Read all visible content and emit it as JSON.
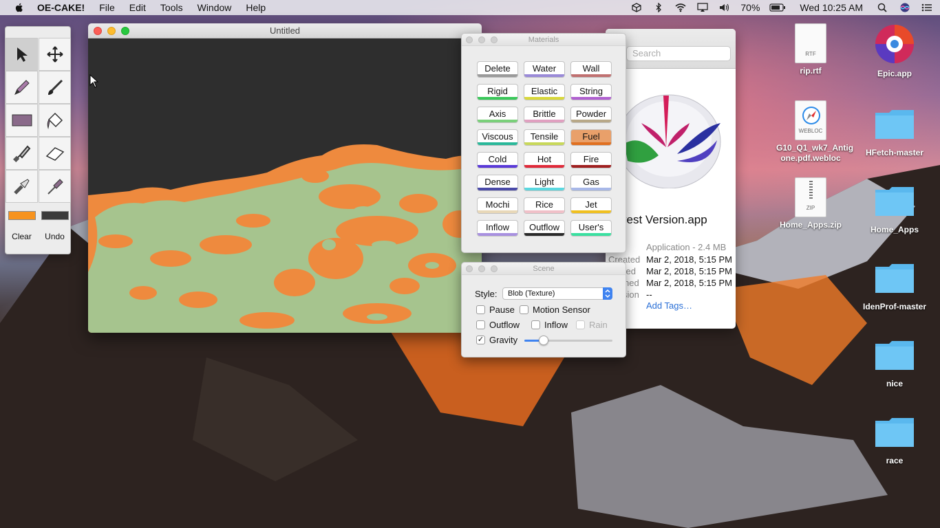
{
  "menubar": {
    "app_name": "OE-CAKE!",
    "items": [
      "File",
      "Edit",
      "Tools",
      "Window",
      "Help"
    ],
    "battery": "70%",
    "clock": "Wed 10:25 AM"
  },
  "palette": {
    "tools": [
      "arrow-select",
      "move",
      "pencil",
      "brush",
      "rectangle",
      "paint-bucket",
      "knife",
      "eraser",
      "flashlight",
      "dropper"
    ],
    "swatch1_color": "#f7931e",
    "swatch2_color": "#3a3a3a",
    "clear_label": "Clear",
    "undo_label": "Undo"
  },
  "canvas_window": {
    "title": "Untitled"
  },
  "finder": {
    "search_placeholder": "Search",
    "app_name_partial": "vest Version.app",
    "kind_size": "Application - 2.4 MB",
    "rows": [
      {
        "key": "Created",
        "value": "Mar 2, 2018, 5:15 PM"
      },
      {
        "key": "fied",
        "value": "Mar 2, 2018, 5:15 PM"
      },
      {
        "key": "ned",
        "value": "Mar 2, 2018, 5:15 PM"
      },
      {
        "key": "sion",
        "value": "--"
      }
    ],
    "add_tags": "Add Tags…",
    "partial_left": "pp"
  },
  "materials": {
    "title": "Materials",
    "items": [
      {
        "label": "Delete",
        "color": "#9a9a9a"
      },
      {
        "label": "Water",
        "color": "#9a8ad8"
      },
      {
        "label": "Wall",
        "color": "#c07070"
      },
      {
        "label": "Rigid",
        "color": "#3ac85a"
      },
      {
        "label": "Elastic",
        "color": "#d8d83a"
      },
      {
        "label": "String",
        "color": "#b060d0"
      },
      {
        "label": "Axis",
        "color": "#7ad07a"
      },
      {
        "label": "Brittle",
        "color": "#e0a0c0"
      },
      {
        "label": "Powder",
        "color": "#b8a888"
      },
      {
        "label": "Viscous",
        "color": "#2ab89a"
      },
      {
        "label": "Tensile",
        "color": "#c8d85a"
      },
      {
        "label": "Fuel",
        "color": "#e07020"
      },
      {
        "label": "Cold",
        "color": "#5a3ad8"
      },
      {
        "label": "Hot",
        "color": "#e02a3a"
      },
      {
        "label": "Fire",
        "color": "#a02020"
      },
      {
        "label": "Dense",
        "color": "#4a4aa8"
      },
      {
        "label": "Light",
        "color": "#5ad8e0"
      },
      {
        "label": "Gas",
        "color": "#a8b8e8"
      },
      {
        "label": "Mochi",
        "color": "#e8d8b8"
      },
      {
        "label": "Rice",
        "color": "#f0c0c8"
      },
      {
        "label": "Jet",
        "color": "#f0c020"
      },
      {
        "label": "Inflow",
        "color": "#a890e0"
      },
      {
        "label": "Outflow",
        "color": "#2a2a2a"
      },
      {
        "label": "User's",
        "color": "#3ae0a0"
      }
    ]
  },
  "scene": {
    "title": "Scene",
    "style_label": "Style:",
    "style_value": "Blob (Texture)",
    "pause": "Pause",
    "motion_sensor": "Motion Sensor",
    "outflow": "Outflow",
    "inflow": "Inflow",
    "rain": "Rain",
    "gravity": "Gravity",
    "gravity_check": "✓",
    "gravity_level": 0.22
  },
  "desktop": {
    "icons": [
      {
        "label": "rip.rtf",
        "type": "doc",
        "ext": "RTF"
      },
      {
        "label": "Epic.app",
        "type": "app"
      },
      {
        "label": "G10_Q1_wk7_Antigone.pdf.webloc",
        "type": "doc",
        "ext": "WEBLOC"
      },
      {
        "label": "HFetch-master",
        "type": "folder"
      },
      {
        "label": "Home_Apps.zip",
        "type": "doc",
        "ext": "ZIP"
      },
      {
        "label": "Home_Apps",
        "type": "folder"
      },
      {
        "label": "IdenProf-master",
        "type": "folder"
      },
      {
        "label": "nice",
        "type": "folder"
      },
      {
        "label": "race",
        "type": "folder"
      }
    ],
    "label_lines": {
      "webloc1": "G10_Q1_wk7_Antig",
      "webloc2": "one.pdf.webloc"
    }
  }
}
